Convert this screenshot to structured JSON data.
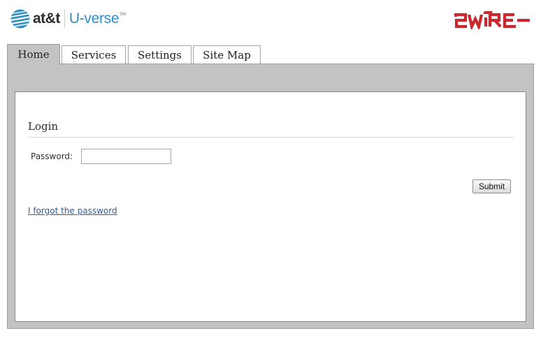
{
  "header": {
    "att_logo": {
      "icon": "att-globe-icon",
      "brand": "at&t",
      "product": "U-verse",
      "mark": "SM"
    },
    "vendor_logo": {
      "text": "2WIRE",
      "color": "#c8282e"
    }
  },
  "tabs": [
    {
      "label": "Home",
      "active": true
    },
    {
      "label": "Services",
      "active": false
    },
    {
      "label": "Settings",
      "active": false
    },
    {
      "label": "Site Map",
      "active": false
    }
  ],
  "login": {
    "title": "Login",
    "password_label": "Password:",
    "password_value": "",
    "password_placeholder": "",
    "submit_label": "Submit",
    "forgot_link": "I forgot the password"
  },
  "colors": {
    "panel_gray": "#c3c3c3",
    "link_blue": "#2a5d9c",
    "uverse_blue": "#2f8fc6",
    "twowire_red": "#c8282e"
  }
}
